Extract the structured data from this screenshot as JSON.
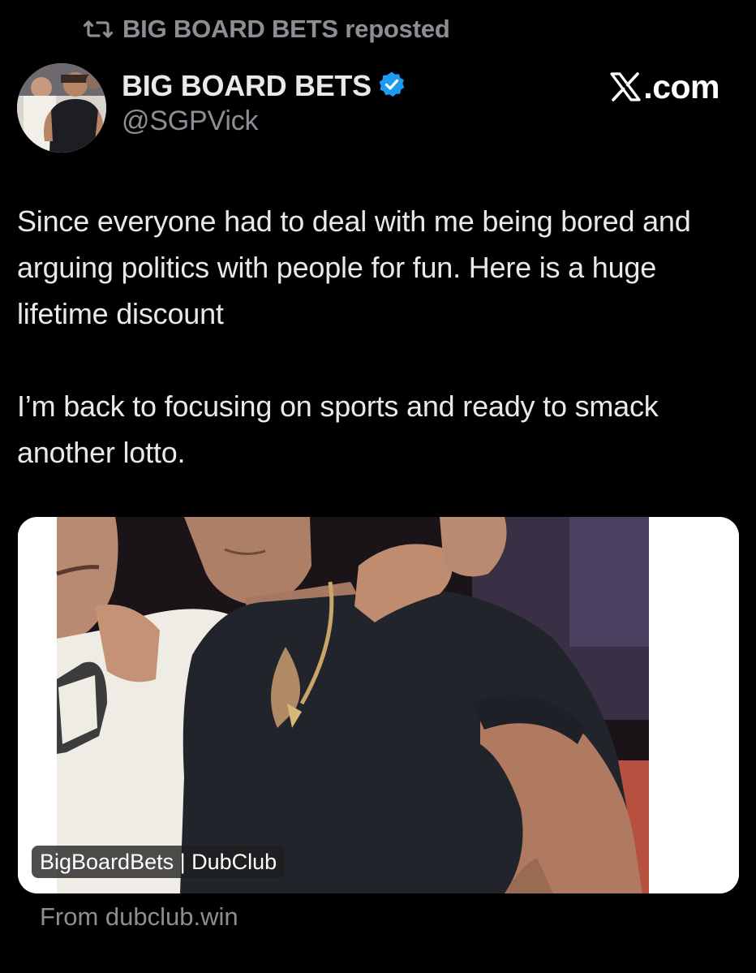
{
  "repost": {
    "icon": "repost-icon",
    "label": "BIG BOARD BETS reposted"
  },
  "author": {
    "avatar": "avatar",
    "name": "BIG BOARD BETS",
    "verified_icon": "verified-badge-icon",
    "handle": "@SGPVick"
  },
  "brand": {
    "icon": "x-logo-icon",
    "label": ".com"
  },
  "post": {
    "text": "Since everyone had to deal with me being bored and arguing politics with people for fun. Here is a huge lifetime discount\n\nI’m back to focusing on sports and ready to smack another lotto."
  },
  "link_card": {
    "overlay_label": "BigBoardBets | DubClub",
    "source": "From dubclub.win"
  },
  "colors": {
    "background": "#000000",
    "text": "#e7e9ea",
    "secondary_text": "#8b8f94",
    "verified_blue": "#1d9bf0",
    "brand": "#ffffff"
  }
}
